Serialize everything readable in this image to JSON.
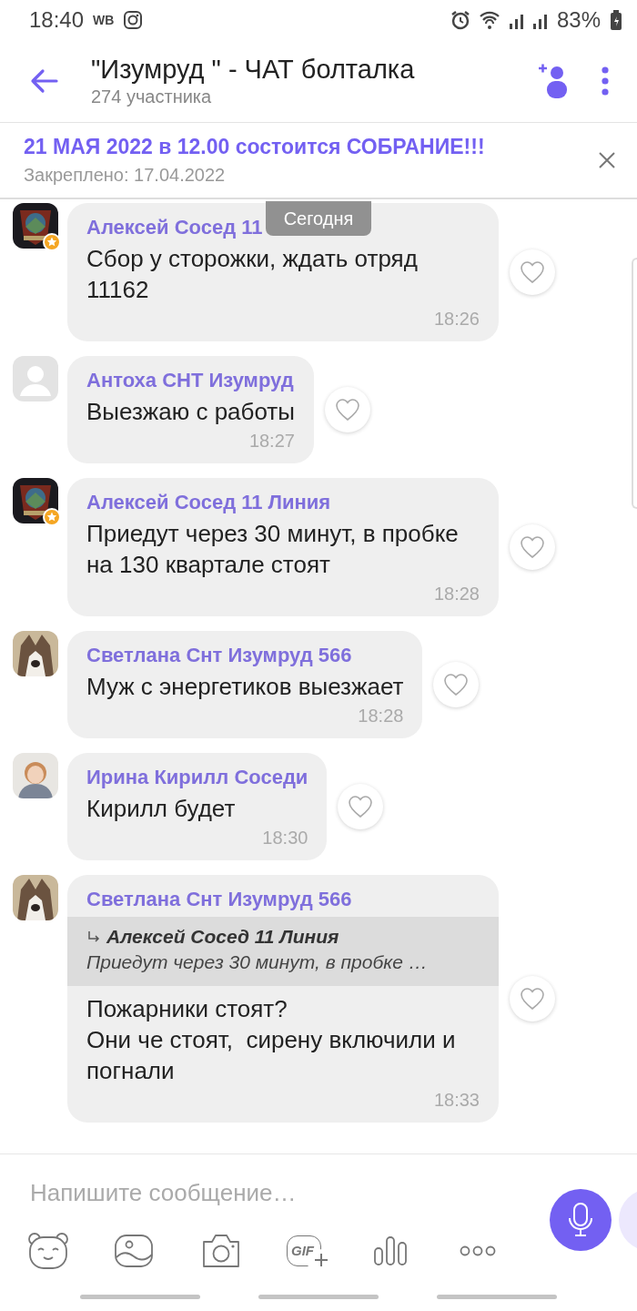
{
  "status_bar": {
    "time": "18:40",
    "carrier_tag": "WB",
    "battery": "83%"
  },
  "header": {
    "title": "\"Изумруд \" - ЧАТ болталка",
    "subtitle": "274 участника"
  },
  "pinned": {
    "text": "21 МАЯ 2022 в 12.00 состоится СОБРАНИЕ!!!",
    "date": "Закреплено: 17.04.2022"
  },
  "date_pill": "Сегодня",
  "messages": [
    {
      "sender": "Алексей Сосед 11",
      "badge": true,
      "text": "Сбор у сторожки, ждать отряд 11162",
      "time": "18:26"
    },
    {
      "sender": "Антоха СНТ Изумруд",
      "avatar": {
        "kind": "placeholder"
      },
      "badge": false,
      "text": "Выезжаю с работы",
      "time": "18:27"
    },
    {
      "sender": "Алексей Сосед 11 Линия",
      "badge": true,
      "text": "Приедут через 30 минут, в пробке на 130 квартале стоят",
      "time": "18:28"
    },
    {
      "sender": "Светлана Снт Изумруд 566",
      "badge": false,
      "text": "Муж с энергетиков выезжает",
      "time": "18:28"
    },
    {
      "sender": "Ирина Кирилл Соседи",
      "badge": false,
      "text": "Кирилл будет",
      "time": "18:30"
    },
    {
      "sender": "Светлана Снт Изумруд 566",
      "badge": false,
      "reply": {
        "sender": "Алексей Сосед 11 Линия",
        "text": "Приедут через 30 минут, в пробке …"
      },
      "text": "Пожарники стоят?\nОни че стоят,  сирену включили и погнали",
      "time": "18:33"
    }
  ],
  "composer": {
    "placeholder": "Напишите сообщение…",
    "gif_label": "GIF"
  }
}
